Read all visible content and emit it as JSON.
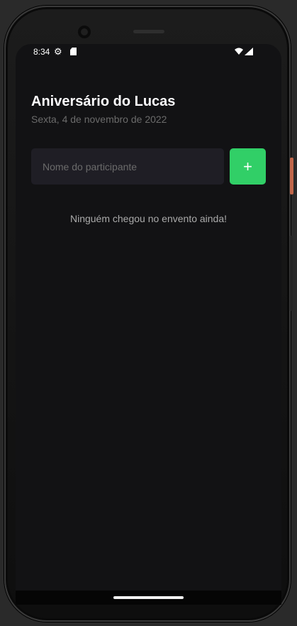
{
  "status_bar": {
    "time": "8:34",
    "gear_icon": "⚙",
    "wifi_icon": "▼",
    "signal_icon": "◢"
  },
  "event": {
    "title": "Aniversário do Lucas",
    "date": "Sexta, 4 de novembro de 2022"
  },
  "form": {
    "input_placeholder": "Nome do participante",
    "input_value": "",
    "add_button_label": "+"
  },
  "participants": {
    "empty_message": "Ninguém chegou no envento ainda!"
  },
  "colors": {
    "background": "#121214",
    "input_background": "#1f1e25",
    "accent_green": "#31cf67",
    "muted_text": "#6b6b6b"
  }
}
